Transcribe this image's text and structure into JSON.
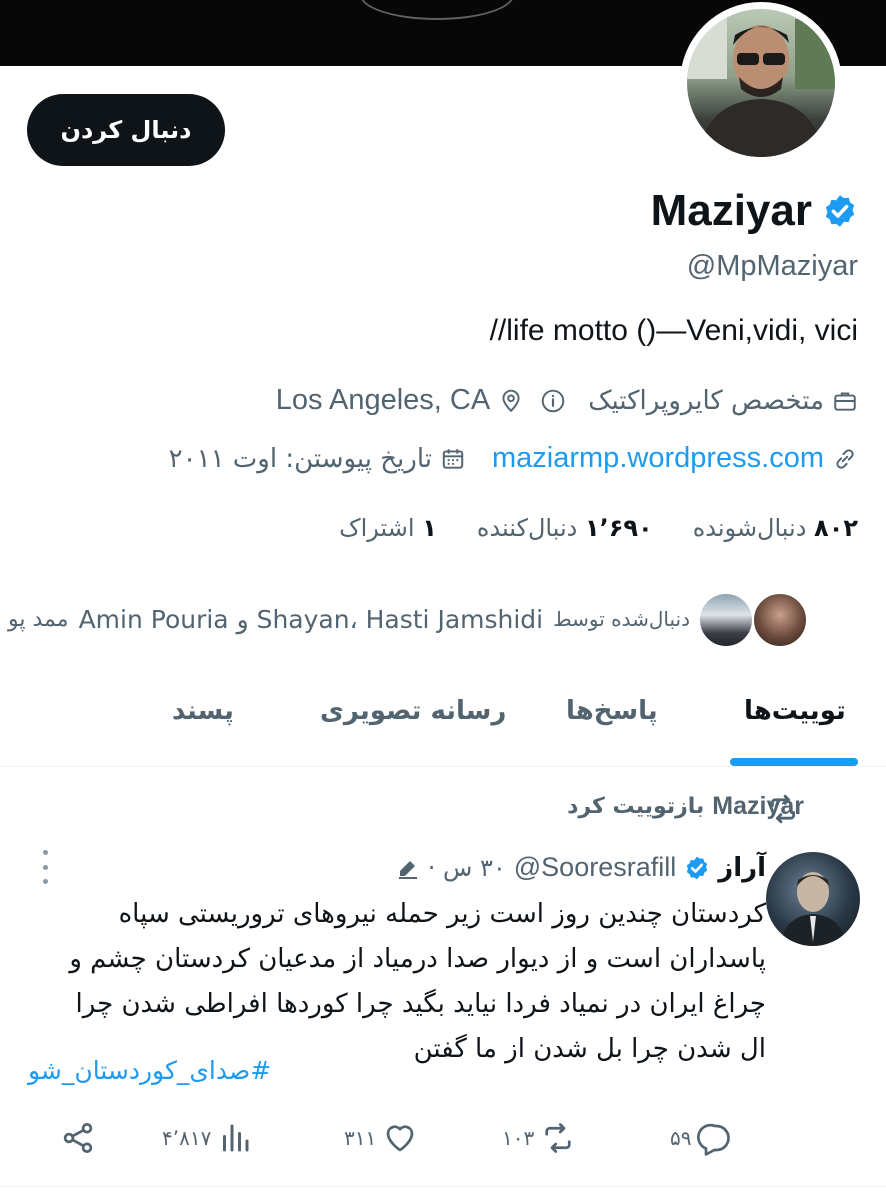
{
  "profile": {
    "display_name": "Maziyar",
    "handle": "@MpMaziyar",
    "bio": "//life motto ()—Veni,vidi, vici",
    "profession": "متخصص کایروپراکتیک",
    "location": "Los Angeles, CA",
    "website": "maziarmp.wordpress.com",
    "joined": "تاریخ پیوستن: اوت ۲۰۱۱",
    "follow_label": "دنبال کردن"
  },
  "stats": {
    "following_count": "۸۰۲",
    "following_label": "دنبال‌شونده",
    "followers_count": "۱٬۶۹۰",
    "followers_label": "دنبال‌کننده",
    "subscriptions_count": "۱",
    "subscriptions_label": "اشتراک"
  },
  "followed_by": {
    "prefix": "دنبال‌شده توسط",
    "names": "Shayan، Hasti Jamshidi و Amin Pouria",
    "suffix": "ممد پو"
  },
  "tabs": [
    {
      "label": "توییت‌ها",
      "active": true
    },
    {
      "label": "پاسخ‌ها",
      "active": false
    },
    {
      "label": "رسانه تصویری",
      "active": false
    },
    {
      "label": "پسند",
      "active": false
    }
  ],
  "tweet": {
    "retweeted_by_name": "Maziyar",
    "retweeted_label": "بازتوییت کرد",
    "author_name": "آراز",
    "author_handle": "@Sooresrafill",
    "time": "۳۰ س ·",
    "lines": [
      "کردستان چندین روز است زیر حمله نیروهای تروریستی سپاه",
      "پاسداران است و از دیوار صدا درمیاد از مدعیان کردستان چشم و",
      "چراغ ایران در نمیاد فردا نیاید بگید چرا کوردها افراطی شدن چرا",
      "ال شدن چرا بل شدن از ما گفتن"
    ],
    "hashtag": "#صدای_کوردستان_شو",
    "replies": "۵۹",
    "retweets": "۱۰۳",
    "likes": "۳۱۱",
    "views": "۴٬۸۱۷"
  },
  "colors": {
    "accent": "#1d9bf0",
    "text": "#0f1419",
    "muted": "#536471"
  }
}
